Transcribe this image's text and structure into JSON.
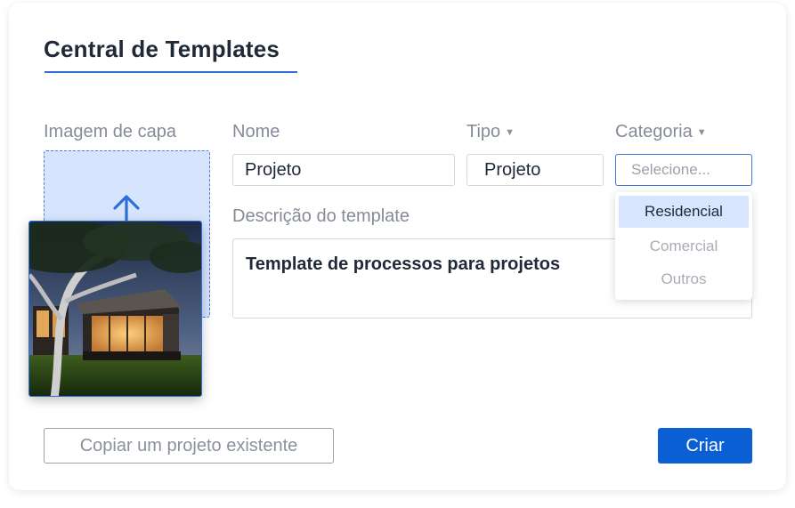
{
  "form": {
    "title": "Central de Templates",
    "cover_label": "Imagem de capa",
    "name_label": "Nome",
    "name_value": "Projeto",
    "type_label": "Tipo",
    "type_value": "Projeto",
    "category_label": "Categoria",
    "category_placeholder": "Selecione...",
    "category_options": [
      "Residencial",
      "Comercial",
      "Outros"
    ],
    "category_highlighted": "Residencial",
    "description_label": "Descrição do template",
    "description_value": "Template de processos para projetos"
  },
  "actions": {
    "copy_label": "Copiar um projeto existente",
    "create_label": "Criar"
  },
  "icons": {
    "upload": "upload-arrow-icon",
    "caret": "caret-down-icon"
  },
  "colors": {
    "accent": "#2f6fd6",
    "primary_button": "#0b5fd4",
    "upload_fill": "#d6e4fd",
    "dropdown_highlight": "#d7e5fe"
  }
}
